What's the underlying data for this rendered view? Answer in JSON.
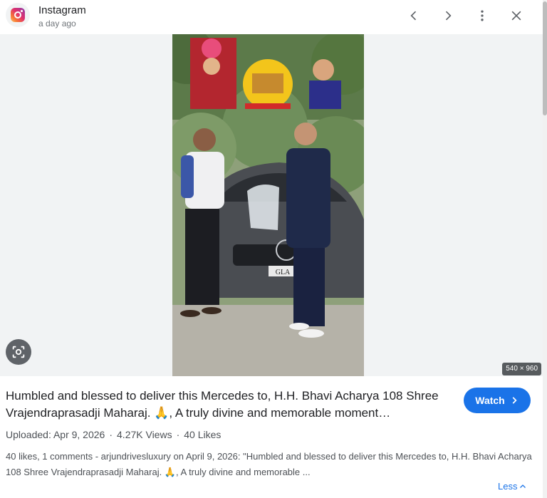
{
  "header": {
    "source_name": "Instagram",
    "source_time": "a day ago",
    "icons": [
      "instagram-logo",
      "chevron-left-icon",
      "chevron-right-icon",
      "more-vert-icon",
      "close-icon"
    ]
  },
  "viewer": {
    "dimensions": "540 × 960",
    "lens_icon": "google-lens-icon",
    "photo_caption_plate": "GLA"
  },
  "details": {
    "title": "Humbled and blessed to deliver this Mercedes to, H.H. Bhavi Acharya 108 Shree Vrajendraprasadji Maharaj. 🙏, A truly divine and memorable moment…",
    "watch_label": "Watch",
    "meta": {
      "uploaded": "Uploaded: Apr 9, 2026",
      "views": "4.27K Views",
      "likes": "40 Likes"
    },
    "description": "40 likes, 1 comments - arjundrivesluxury on April 9, 2026: \"Humbled and blessed to deliver this Mercedes to, H.H. Bhavi Acharya 108 Shree Vrajendraprasadji Maharaj. 🙏, A truly divine and memorable ...",
    "less_label": "Less"
  },
  "colors": {
    "accent": "#1a73e8",
    "viewer_bg": "#f1f3f4",
    "muted_text": "#4d5156"
  }
}
